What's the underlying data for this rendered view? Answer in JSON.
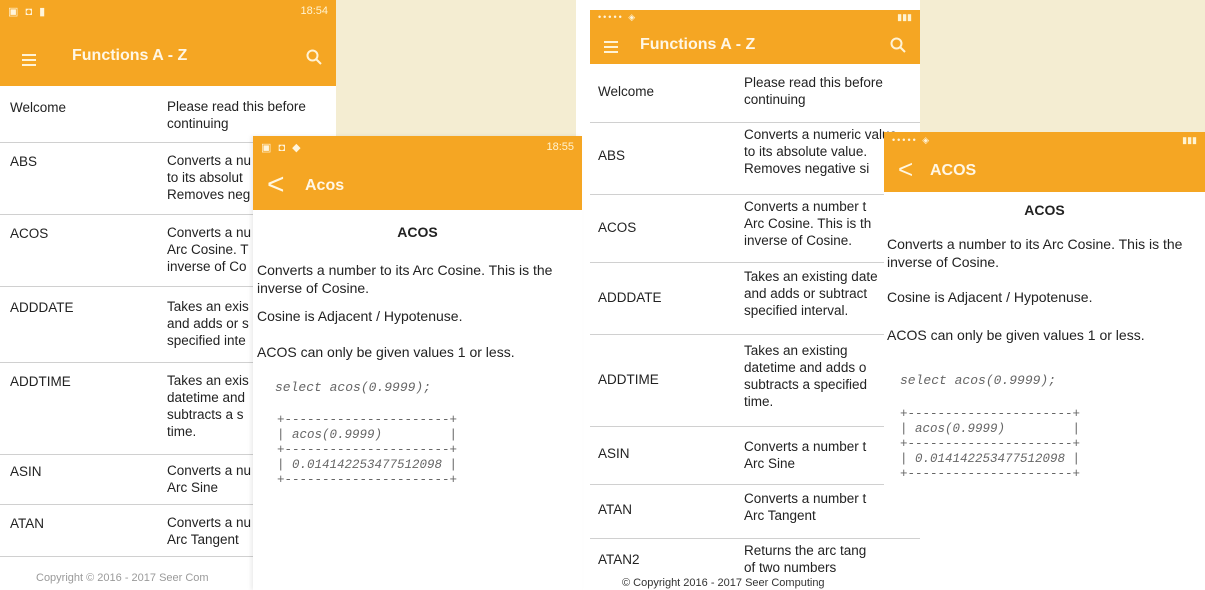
{
  "colors": {
    "accent": "#f5a623",
    "divider": "#d0d0d0",
    "background_strip": "#f4edd2"
  },
  "left_list_screen": {
    "status_time": "18:54",
    "title": "Functions A - Z",
    "rows": [
      {
        "name": "Welcome",
        "desc": "Please read this before\ncontinuing"
      },
      {
        "name": "ABS",
        "desc": "Converts a nu\nto its absolut\nRemoves neg"
      },
      {
        "name": "ACOS",
        "desc": "Converts a nu\nArc Cosine. T\ninverse of Co"
      },
      {
        "name": "ADDDATE",
        "desc": "Takes an exis\nand adds or s\nspecified inte"
      },
      {
        "name": "ADDTIME",
        "desc": "Takes an exis\ndatetime and\nsubtracts a s\ntime."
      },
      {
        "name": "ASIN",
        "desc": "Converts a nu\nArc Sine"
      },
      {
        "name": "ATAN",
        "desc": "Converts a nu\nArc Tangent"
      }
    ],
    "copyright": "Copyright © 2016 - 2017 Seer Com"
  },
  "left_detail_screen": {
    "status_time": "18:55",
    "title": "Acos",
    "heading": "ACOS",
    "para1": "Converts a number to its Arc Cosine. This is the inverse of Cosine.",
    "para2": "Cosine is Adjacent / Hypotenuse.",
    "para3": "ACOS can only be given values 1 or less.",
    "code": "select acos(0.9999);",
    "table": "+----------------------+\n| acos(0.9999)         |\n+----------------------+\n| 0.014142253477512098 |\n+----------------------+"
  },
  "right_list_screen": {
    "title": "Functions A - Z",
    "rows": [
      {
        "name": "Welcome",
        "desc": "Please read this before\ncontinuing"
      },
      {
        "name": "ABS",
        "desc": "Converts a numeric value\nto its absolute value.\nRemoves negative si"
      },
      {
        "name": "ACOS",
        "desc": "Converts a number t\nArc Cosine. This is th\ninverse of Cosine."
      },
      {
        "name": "ADDDATE",
        "desc": "Takes an existing date\nand adds or subtract\nspecified interval."
      },
      {
        "name": "ADDTIME",
        "desc": "Takes an existing\ndatetime and adds o\nsubtracts a specified\ntime."
      },
      {
        "name": "ASIN",
        "desc": "Converts a number t\nArc Sine"
      },
      {
        "name": "ATAN",
        "desc": "Converts a number t\nArc Tangent"
      },
      {
        "name": "ATAN2",
        "desc": "Returns the arc tang\nof two numbers"
      }
    ],
    "copyright": "© Copyright 2016 - 2017 Seer Computing"
  },
  "right_detail_screen": {
    "title": "ACOS",
    "heading": "ACOS",
    "para1": "Converts a number to its Arc Cosine. This is the inverse of Cosine.",
    "para2": "Cosine is Adjacent / Hypotenuse.",
    "para3": "ACOS can only be given values 1 or less.",
    "code": "select acos(0.9999);",
    "table": "+----------------------+\n| acos(0.9999)         |\n+----------------------+\n| 0.014142253477512098 |\n+----------------------+"
  }
}
